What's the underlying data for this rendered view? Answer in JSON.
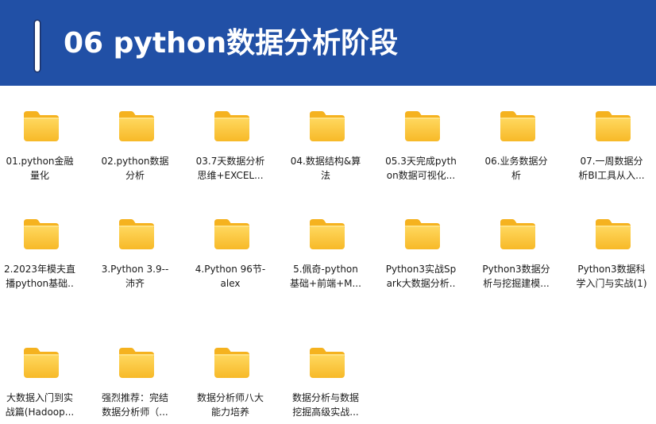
{
  "header": {
    "title": "06 python数据分析阶段"
  },
  "folders": [
    {
      "line1": "01.python金融",
      "line2": "量化"
    },
    {
      "line1": "02.python数据",
      "line2": "分析"
    },
    {
      "line1": "03.7天数据分析",
      "line2": "思维+EXCEL..."
    },
    {
      "line1": "04.数据结构&算",
      "line2": "法"
    },
    {
      "line1": "05.3天完成pyth",
      "line2": "on数据可视化..."
    },
    {
      "line1": "06.业务数据分",
      "line2": "析"
    },
    {
      "line1": "07.一周数据分",
      "line2": "析BI工具从入..."
    },
    {
      "line1": "2.2023年模夫直",
      "line2": "播python基础.."
    },
    {
      "line1": "3.Python 3.9--",
      "line2": "沛齐"
    },
    {
      "line1": "4.Python 96节-",
      "line2": "alex"
    },
    {
      "line1": "5.佩奇-python",
      "line2": "基础+前端+M..."
    },
    {
      "line1": "Python3实战Sp",
      "line2": "ark大数据分析.."
    },
    {
      "line1": "Python3数据分",
      "line2": "析与挖掘建模..."
    },
    {
      "line1": "Python3数据科",
      "line2": "学入门与实战(1)"
    },
    {
      "line1": "大数据入门到实",
      "line2": "战篇(Hadoop..."
    },
    {
      "line1": "强烈推荐：完结",
      "line2": "数据分析师（..."
    },
    {
      "line1": "数据分析师八大",
      "line2": "能力培养"
    },
    {
      "line1": "数据分析与数据",
      "line2": "挖掘高级实战..."
    }
  ]
}
